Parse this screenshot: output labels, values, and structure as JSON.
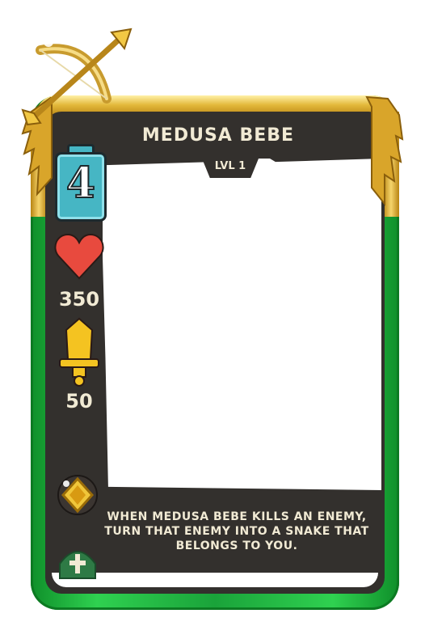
{
  "card": {
    "name": "MEDUSA BEBE",
    "level": "LVL 1",
    "mana_cost": "4",
    "health": "350",
    "attack": "50",
    "ability_text": "WHEN MEDUSA BEBE KILLS AN ENEMY, TURN THAT ENEMY INTO A SNAKE THAT BELONGS TO YOU."
  },
  "icons": {
    "class_emblem": "bow-and-arrow-icon",
    "mana": "mana-crystal-icon",
    "health": "heart-icon",
    "attack": "sword-icon",
    "ability": "gem-icon",
    "faction": "bishop-mitre-icon"
  },
  "colors": {
    "frame": "#2fd150",
    "frame_trim": "#e3b93b",
    "panel": "#33302d",
    "text": "#f1ead4",
    "mana": "#46b6c4",
    "heart": "#e84a3e",
    "sword": "#f4c321",
    "faction": "#2e7a45"
  }
}
